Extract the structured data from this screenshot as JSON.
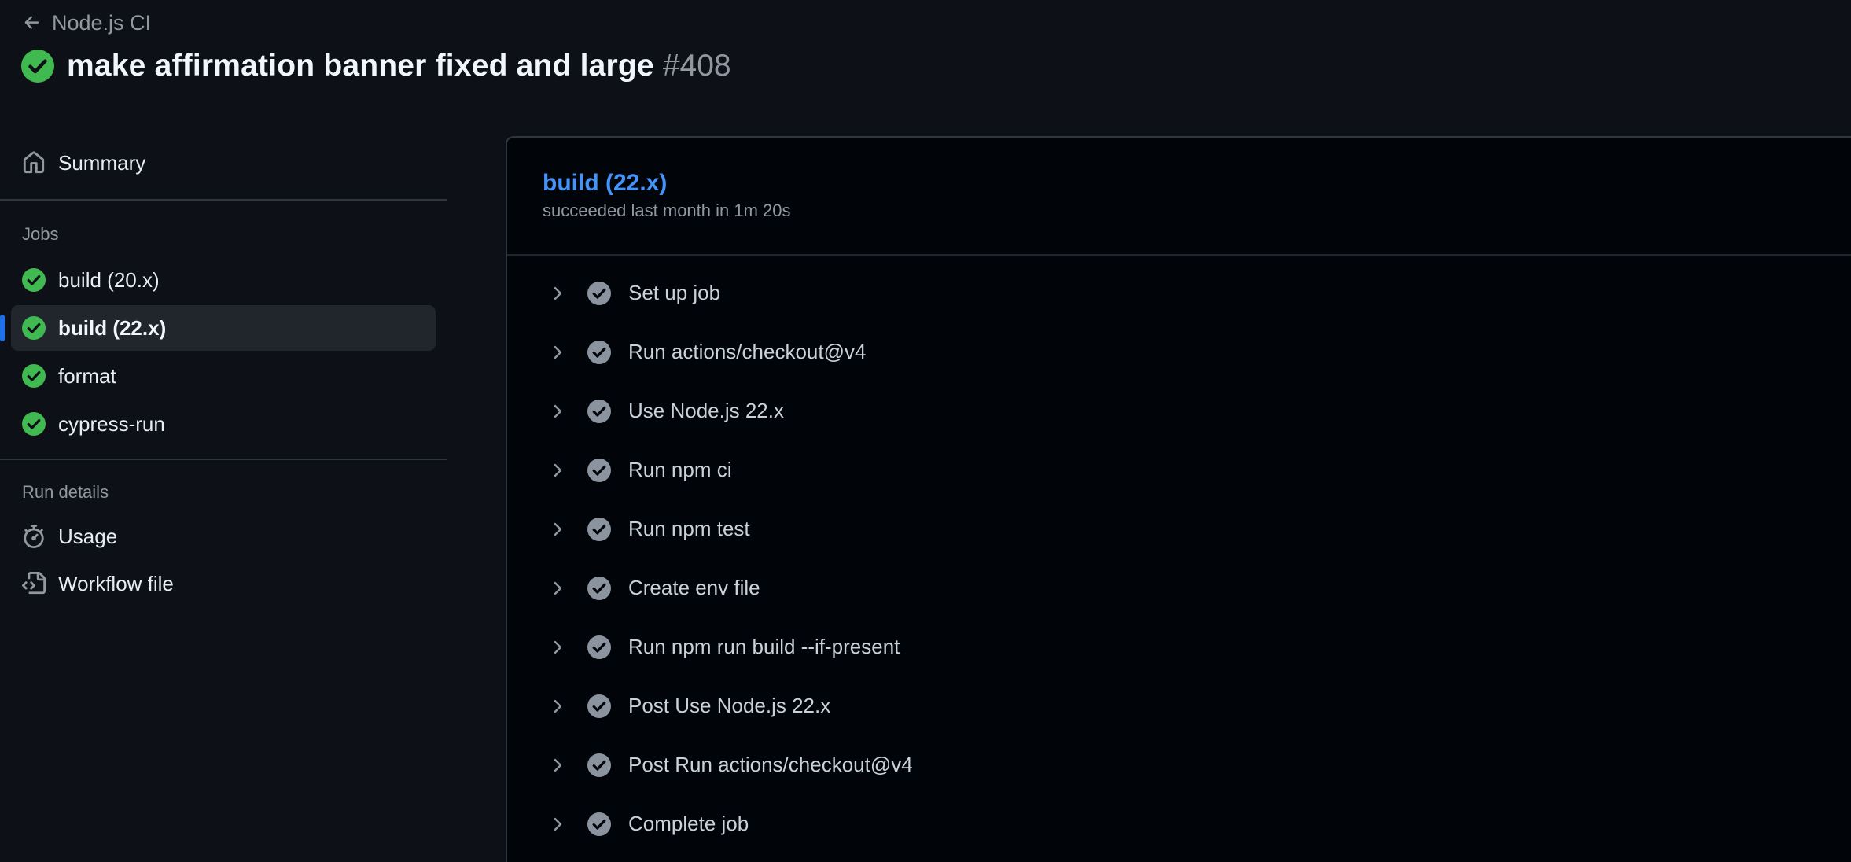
{
  "header": {
    "back_label": "Node.js CI",
    "title": "make affirmation banner fixed and large",
    "run_number": "#408"
  },
  "sidebar": {
    "summary_label": "Summary",
    "jobs_heading": "Jobs",
    "jobs": [
      {
        "label": "build (20.x)",
        "status": "success"
      },
      {
        "label": "build (22.x)",
        "status": "success",
        "active": true
      },
      {
        "label": "format",
        "status": "success"
      },
      {
        "label": "cypress-run",
        "status": "success"
      }
    ],
    "run_details_heading": "Run details",
    "usage_label": "Usage",
    "workflow_file_label": "Workflow file"
  },
  "job": {
    "title": "build (22.x)",
    "subtitle": "succeeded last month in 1m 20s",
    "steps": [
      {
        "label": "Set up job"
      },
      {
        "label": "Run actions/checkout@v4"
      },
      {
        "label": "Use Node.js 22.x"
      },
      {
        "label": "Run npm ci"
      },
      {
        "label": "Run npm test"
      },
      {
        "label": "Create env file"
      },
      {
        "label": "Run npm run build --if-present"
      },
      {
        "label": "Post Use Node.js 22.x"
      },
      {
        "label": "Post Run actions/checkout@v4"
      },
      {
        "label": "Complete job"
      }
    ]
  },
  "colors": {
    "background": "#0d1117",
    "panel": "#010409",
    "success": "#3fb950",
    "accent": "#4493f8",
    "active_indicator": "#1f6feb",
    "muted": "#9198a1"
  },
  "icons": {
    "back": "arrow-left-icon",
    "title_status": "check-circle-fill-icon",
    "summary": "home-icon",
    "usage": "stopwatch-icon",
    "workflow_file": "file-code-icon",
    "step_expand": "chevron-right-icon",
    "step_status": "check-circle-fill-icon"
  }
}
